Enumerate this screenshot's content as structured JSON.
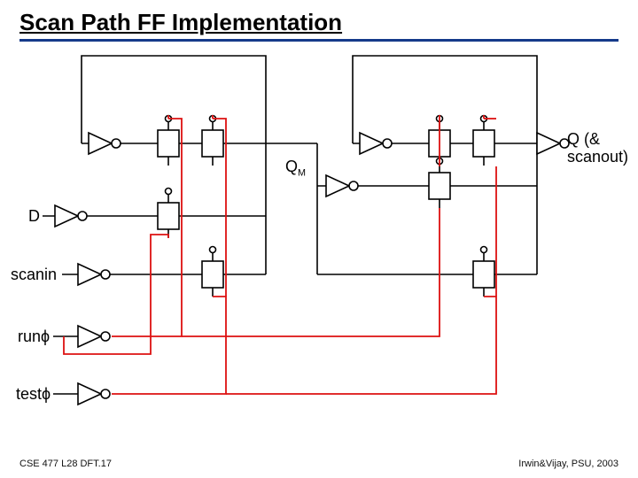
{
  "title": "Scan Path FF Implementation",
  "labels": {
    "qm": "Q",
    "qm_sub": "M",
    "qout1": "Q (&",
    "qout2": "scanout)",
    "d": "D",
    "scanin": "scanin",
    "runphi": "runϕ",
    "testphi": "testϕ"
  },
  "footer": {
    "left": "CSE 477  L28 DFT.17",
    "right": "Irwin&Vijay, PSU, 2003"
  },
  "diagram_semantics": {
    "purpose": "Transistor-level schematic of a scan-path master-slave flip-flop with separate run and test clocks and a scanin input",
    "inputs": [
      "D",
      "scanin",
      "runϕ",
      "testϕ"
    ],
    "outputs": [
      "Q (scanout)"
    ],
    "internal_nodes": [
      "Q_M"
    ],
    "stages": [
      "master latch",
      "slave latch"
    ],
    "primitives": [
      "inverter",
      "pass-transistor (transmission gate style)"
    ],
    "wire_colors": {
      "black": "data path and internal nodes",
      "red": "clock / control routing for runϕ and testϕ"
    }
  }
}
